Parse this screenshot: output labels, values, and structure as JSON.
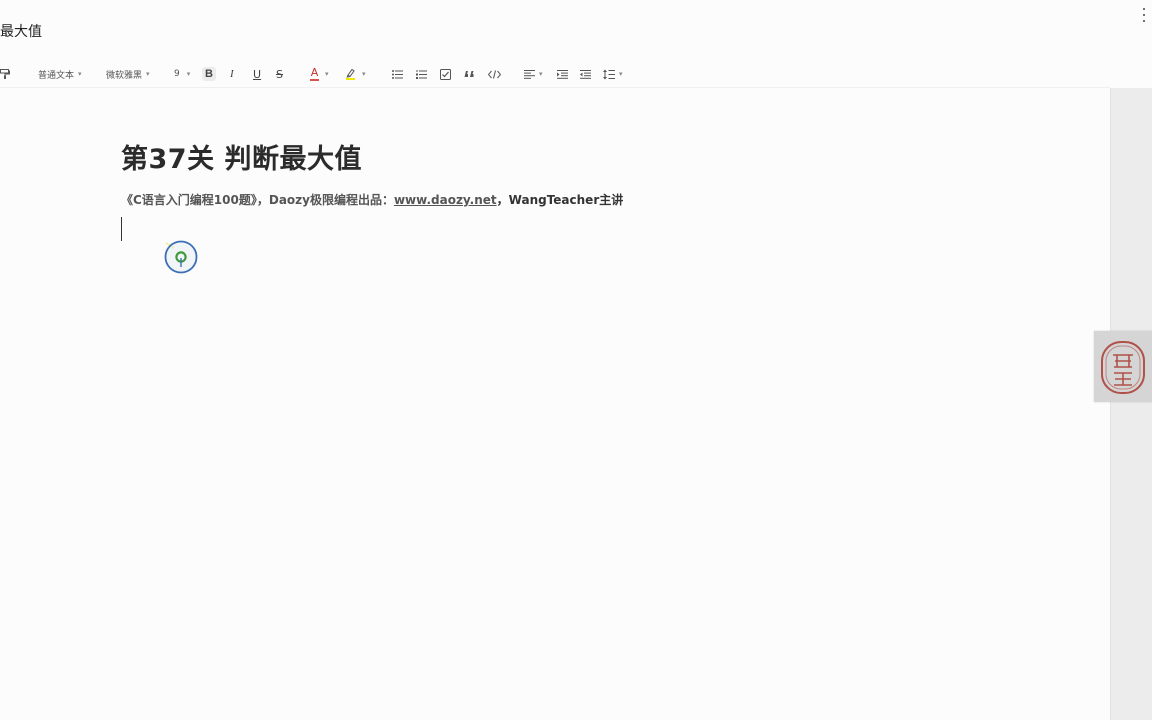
{
  "document": {
    "tab_title": "断最大值"
  },
  "toolbar": {
    "paragraph_style": "普通文本",
    "font_family_value": "微软雅黑",
    "font_size_value": "9",
    "bold_label": "B",
    "italic_label": "I",
    "underline_label": "U",
    "strike_label": "S",
    "font_color_label": "A"
  },
  "content": {
    "heading": "第37关 判断最大值",
    "subtitle_prefix": "《C语言入门编程100题》，Daozy极限编程出品：",
    "subtitle_link": "www.daozy.net",
    "subtitle_sep": "，",
    "subtitle_suffix": "WangTeacher主讲"
  },
  "colors": {
    "font_color_underline": "#d9534f",
    "highlight_underline": "#f3e600",
    "click_ring": "#3b6fb6",
    "click_dot": "#3d9a3d",
    "seal_red": "#b0524a"
  }
}
